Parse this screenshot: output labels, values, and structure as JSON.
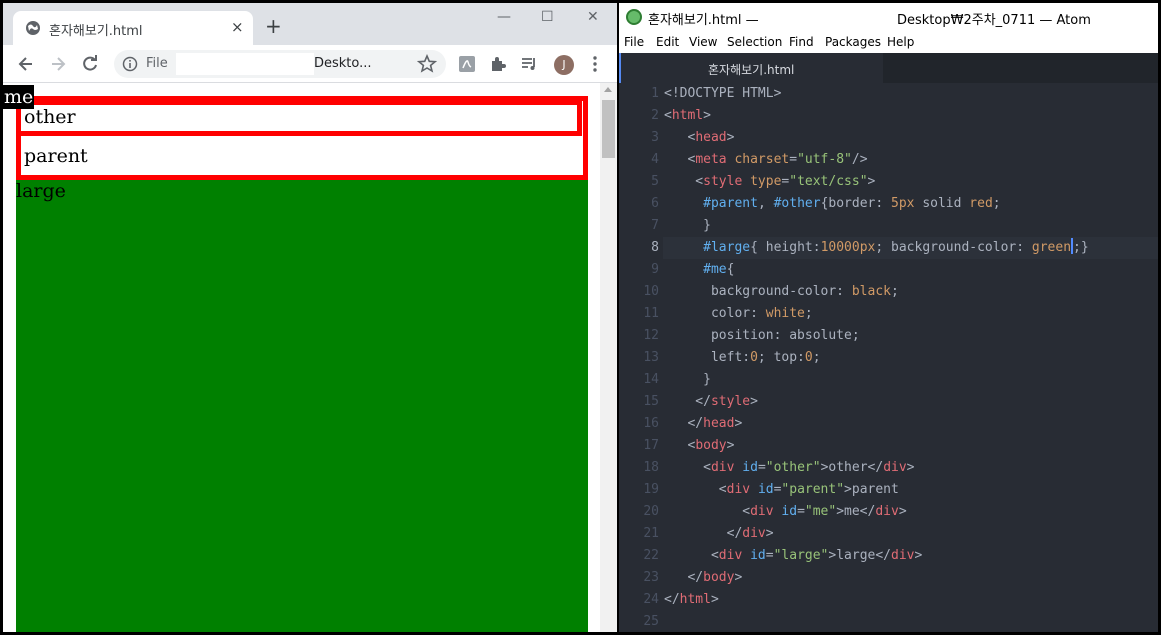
{
  "browser": {
    "tab_title": "혼자해보기.html",
    "tab_close": "×",
    "new_tab": "+",
    "win_min": "—",
    "win_max": "☐",
    "win_close": "✕",
    "scheme": "File",
    "url": "Deskto...",
    "avatar_letter": "J",
    "page": {
      "me_text": "me",
      "other_text": "other",
      "parent_text": "parent",
      "large_text": "large"
    }
  },
  "atom": {
    "title_left": "혼자해보기.html —",
    "title_right": "Desktop₩2주차_0711 — Atom",
    "menu": [
      "File",
      "Edit",
      "View",
      "Selection",
      "Find",
      "Packages",
      "Help"
    ],
    "tab_title": "혼자해보기.html",
    "active_line": 8,
    "line_count": 25
  },
  "colors": {
    "red": "#ff0000",
    "green": "#008000",
    "atom_bg": "#282c34"
  }
}
